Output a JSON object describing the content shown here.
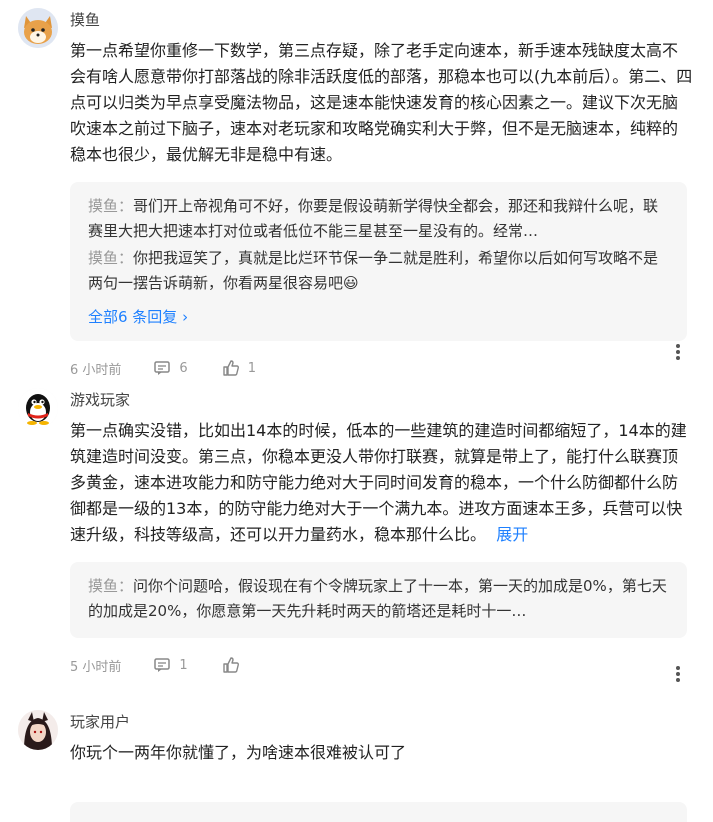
{
  "comments": [
    {
      "user": "摸鱼",
      "text": "第一点希望你重修一下数学，第三点存疑，除了老手定向速本，新手速本残缺度太高不会有啥人愿意带你打部落战的除非活跃度低的部落，那稳本也可以(九本前后）。第二、四点可以归类为早点享受魔法物品，这是速本能快速发育的核心因素之一。建议下次无脑吹速本之前过下脑子，速本对老玩家和攻略党确实利大于弊，但不是无脑速本，纯粹的稳本也很少，最优解无非是稳中有速。",
      "replies": [
        {
          "name": "摸鱼：",
          "text": "哥们开上帝视角可不好，你要是假设萌新学得快全都会，那还和我辩什么呢，联赛里大把大把速本打对位或者低位不能三星甚至一星没有的。经常…"
        },
        {
          "name": "摸鱼：",
          "text": "你把我逗笑了，真就是比烂环节保一争二就是胜利，希望你以后如何写攻略不是两句一摆告诉萌新，你看两星很容易吧😃"
        }
      ],
      "see_all": "全部6 条回复 ›",
      "time": "6 小时前",
      "reply_count": "6",
      "like_count": "1"
    },
    {
      "user": "游戏玩家",
      "text": "第一点确实没错，比如出14本的时候，低本的一些建筑的建造时间都缩短了，14本的建筑建造时间没变。第三点，你稳本更没人带你打联赛，就算是带上了，能打什么联赛顶多黄金，速本进攻能力和防守能力绝对大于同时间发育的稳本，一个什么防御都什么防御都是一级的13本，的防守能力绝对大于一个满九本。进攻方面速本王多，兵营可以快速升级，科技等级高，还可以开力量药水，稳本那什么比。",
      "expand": "展开",
      "replies": [
        {
          "name": "摸鱼：",
          "text": "问你个问题哈，假设现在有个令牌玩家上了十一本，第一天的加成是0%，第七天的加成是20%，你愿意第一天先升耗时两天的箭塔还是耗时十一…"
        }
      ],
      "time": "5 小时前",
      "reply_count": "1",
      "like_count": ""
    },
    {
      "user": "玩家用户",
      "text": "你玩个一两年你就懂了，为啥速本很难被认可了"
    }
  ]
}
